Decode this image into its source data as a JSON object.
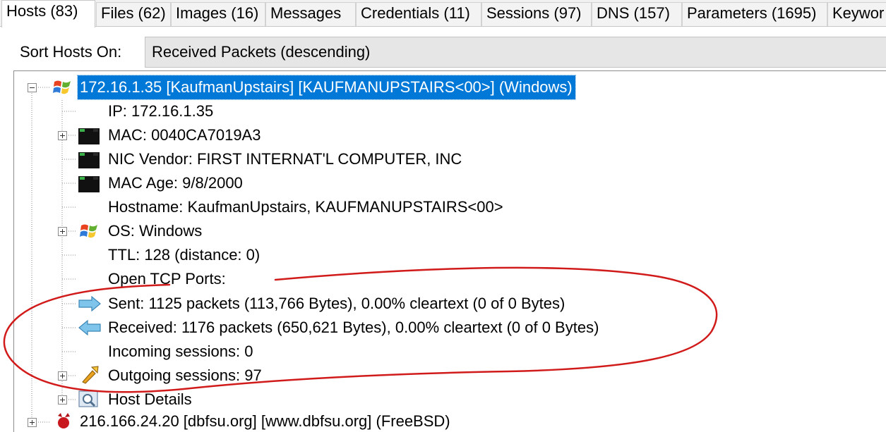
{
  "tabs": [
    {
      "label": "Hosts (83)",
      "selected": true
    },
    {
      "label": "Files (62)"
    },
    {
      "label": "Images (16)"
    },
    {
      "label": "Messages"
    },
    {
      "label": "Credentials (11)"
    },
    {
      "label": "Sessions (97)"
    },
    {
      "label": "DNS (157)"
    },
    {
      "label": "Parameters (1695)"
    },
    {
      "label": "Keywor"
    }
  ],
  "sort": {
    "label": "Sort Hosts On:",
    "value": "Received Packets (descending)"
  },
  "tree": {
    "host_root": "172.16.1.35 [KaufmanUpstairs] [KAUFMANUPSTAIRS<00>] (Windows)",
    "rows": {
      "ip": "IP: 172.16.1.35",
      "mac": "MAC: 0040CA7019A3",
      "nic_vendor": "NIC Vendor: FIRST INTERNAT'L COMPUTER, INC",
      "mac_age": "MAC Age: 9/8/2000",
      "hostname": "Hostname: KaufmanUpstairs, KAUFMANUPSTAIRS<00>",
      "os": "OS: Windows",
      "ttl": "TTL: 128 (distance: 0)",
      "open_tcp_ports": "Open TCP Ports:",
      "sent": "Sent: 1125 packets (113,766 Bytes), 0.00% cleartext (0 of 0 Bytes)",
      "received": "Received: 1176 packets (650,621 Bytes), 0.00% cleartext (0 of 0 Bytes)",
      "incoming_sessions": "Incoming sessions: 0",
      "outgoing_sessions": "Outgoing sessions: 97",
      "host_details": "Host Details"
    },
    "next_host": "216.166.24.20 [dbfsu.org] [www.dbfsu.org] (FreeBSD)"
  },
  "colors": {
    "selection": "#0078d7",
    "annotation": "#d11a1a",
    "tab_background": "#f0f0f0",
    "sort_select_background": "#e6e6e6"
  },
  "icons": {
    "host": "windows-flag-icon",
    "mac": "network-card-icon",
    "os": "windows-flag-icon",
    "sent": "arrow-right-icon",
    "received": "arrow-left-icon",
    "outgoing_sessions": "pencil-arrow-icon",
    "host_details": "magnifier-window-icon",
    "next_host": "freebsd-daemon-icon"
  }
}
